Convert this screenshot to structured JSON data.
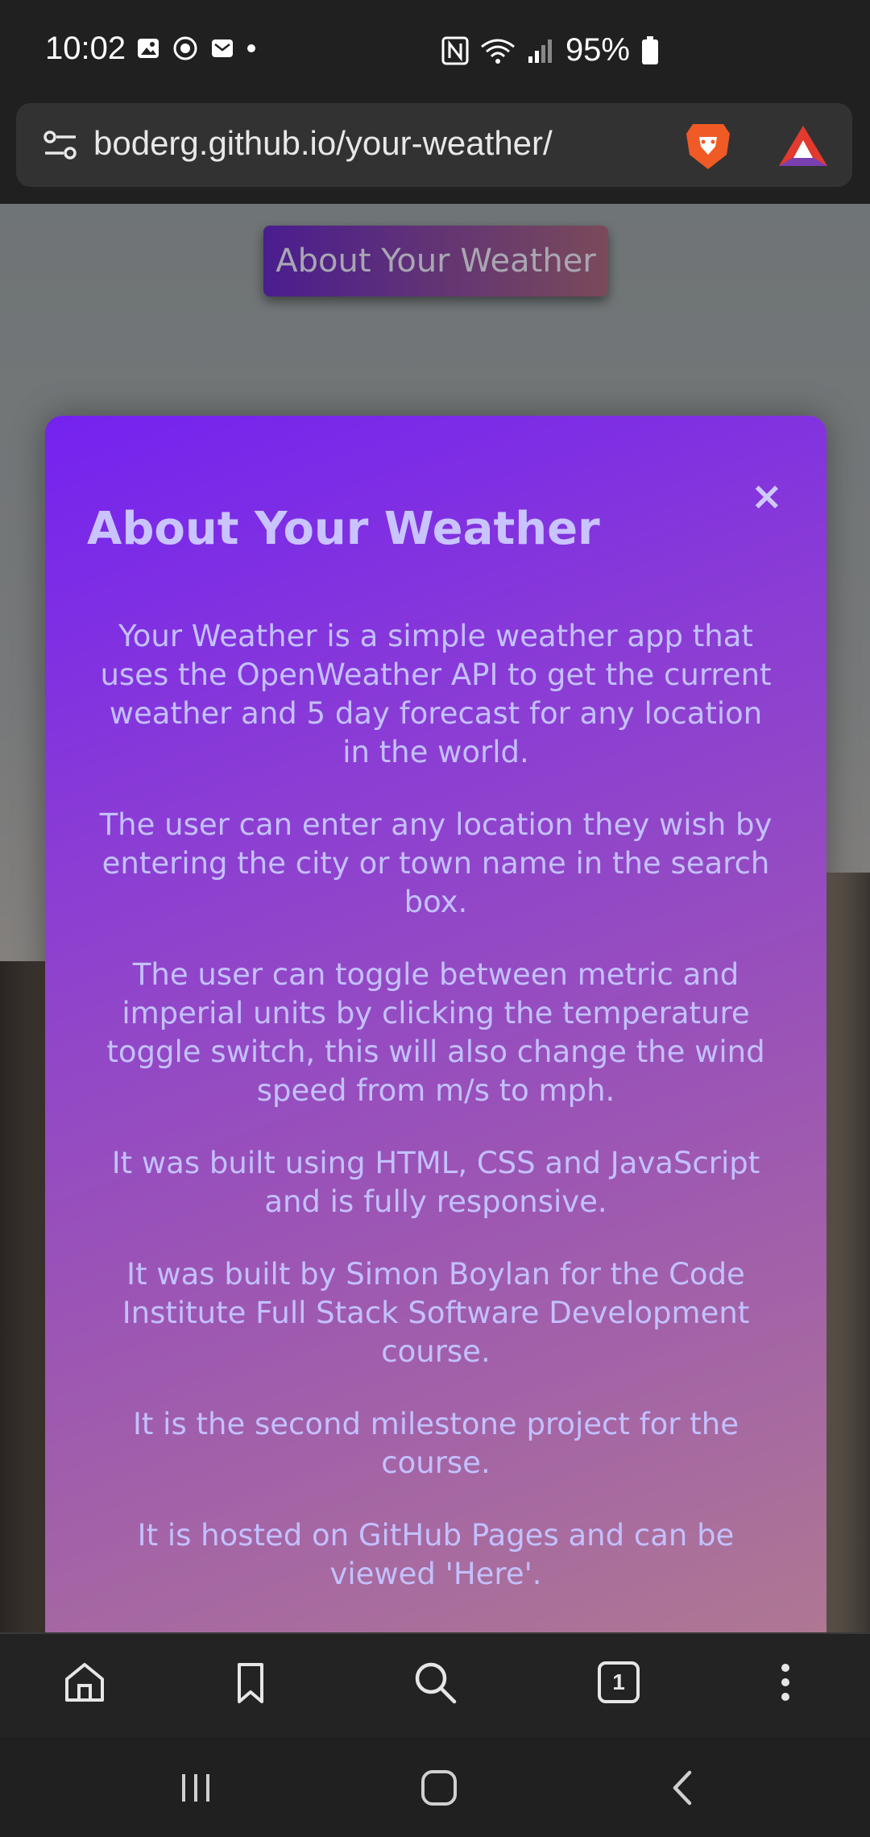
{
  "status": {
    "time": "10:02",
    "battery": "95%"
  },
  "browser": {
    "url": "boderg.github.io/your-weather/",
    "tab_count": "1"
  },
  "page": {
    "about_button": "About Your Weather",
    "modal": {
      "close": "×",
      "title": "About Your Weather",
      "paragraphs": [
        "Your Weather is a simple weather app that uses the OpenWeather API to get the current weather and 5 day forecast for any location in the world.",
        "The user can enter any location they wish by entering the city or town name in the search box.",
        "The user can toggle between metric and imperial units by clicking the temperature toggle switch, this will also change the wind speed from m/s to mph.",
        "It was built using HTML, CSS and JavaScript and is fully responsive.",
        "It was built by Simon Boylan for the Code Institute Full Stack Software Development course.",
        "It is the second milestone project for the course.",
        "It is hosted on GitHub Pages and can be viewed 'Here'."
      ]
    }
  },
  "colors": {
    "modal_start": "#7422f0",
    "modal_end": "#b07a90",
    "modal_text": "#c3c0ff"
  }
}
